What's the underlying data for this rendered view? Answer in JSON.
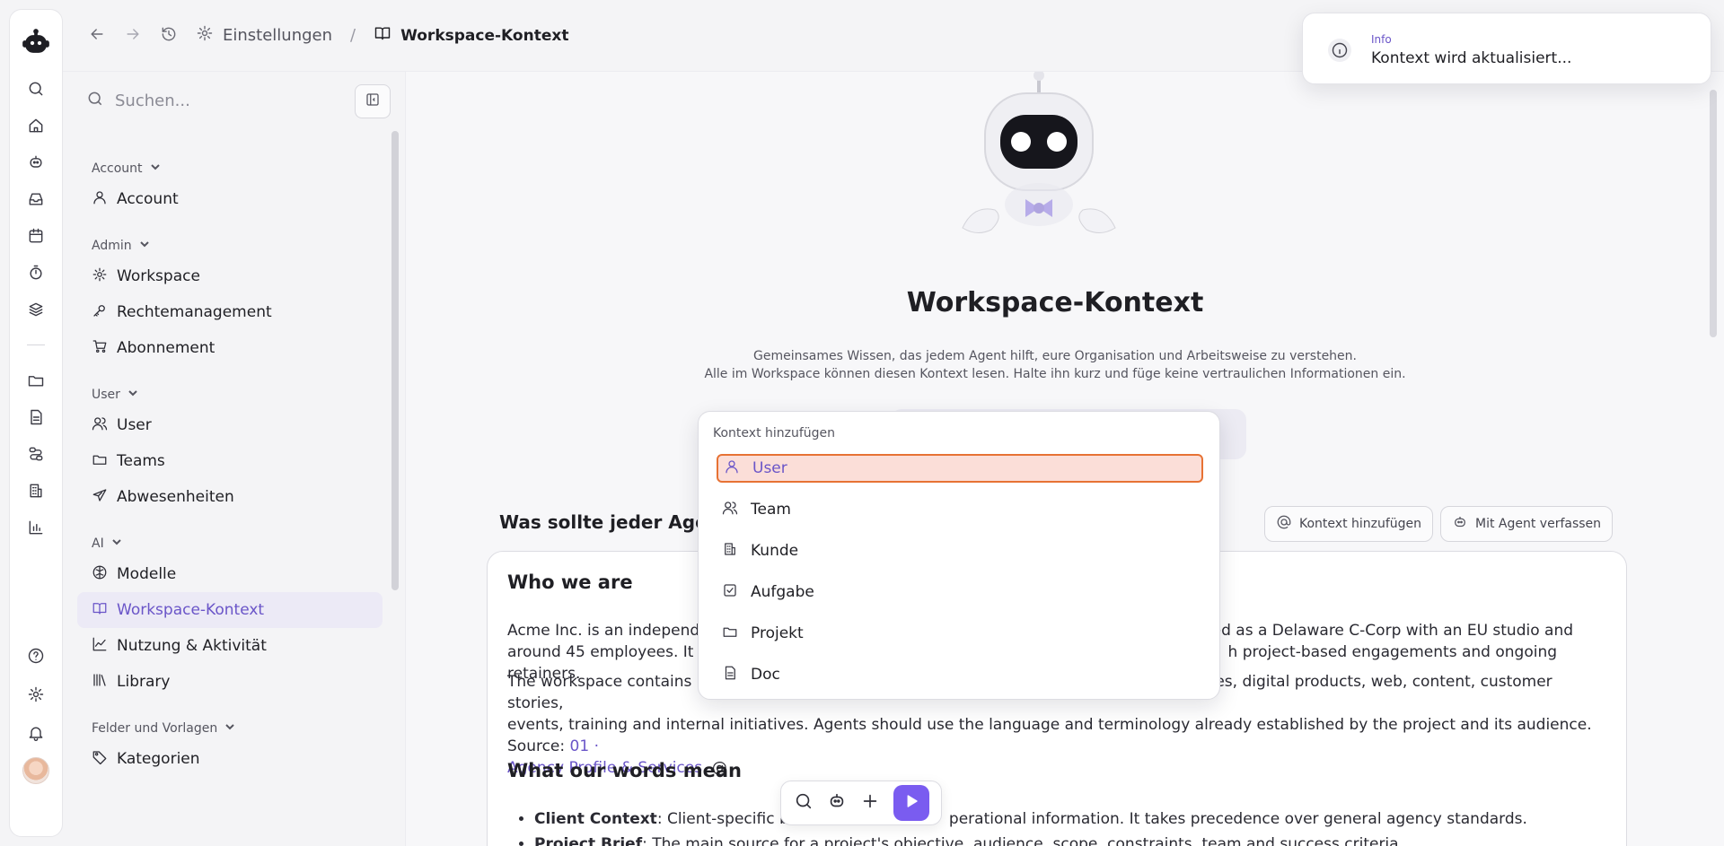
{
  "breadcrumb": {
    "settings": "Einstellungen",
    "separator": "/",
    "current": "Workspace-Kontext"
  },
  "sidebar": {
    "search_placeholder": "Suchen...",
    "sections": [
      {
        "label": "Account",
        "items": [
          "Account"
        ]
      },
      {
        "label": "Admin",
        "items": [
          "Workspace",
          "Rechtemanagement",
          "Abonnement"
        ]
      },
      {
        "label": "User",
        "items": [
          "User",
          "Teams",
          "Abwesenheiten"
        ]
      },
      {
        "label": "AI",
        "items": [
          "Modelle",
          "Workspace-Kontext",
          "Nutzung & Aktivität",
          "Library"
        ]
      },
      {
        "label": "Felder und Vorlagen",
        "items": [
          "Kategorien"
        ]
      }
    ]
  },
  "main": {
    "title": "Workspace-Kontext",
    "subtitle_1": "Gemeinsames Wissen, das jedem Agent hilft, eure Organisation und Arbeitsweise zu verstehen.",
    "subtitle_2": "Alle im Workspace können diesen Kontext lesen. Halte ihn kurz und füge keine vertraulichen Informationen ein.",
    "section_heading": "Was sollte jeder Agent",
    "add_context_label": "Kontext hinzufügen",
    "compose_label": "Mit Agent verfassen",
    "editor": {
      "h1": "Who we are",
      "p1_line1_a": "Acme Inc. is an independe",
      "p1_line1_b": "ed as a Delaware C-Corp with an EU studio and",
      "p1_line2_a": "around 45 employees. It su",
      "p1_line2_b": "h project-based engagements and ongoing retainers.",
      "p2_line1_a": "The workspace contains En",
      "p2_line1_b": "es, digital products, web, content, customer stories,",
      "p2_line2": "events, training and internal initiatives. Agents should use the language and terminology already established by the project and its audience. Source: ",
      "p2_link_a": "01 ·",
      "p2_link_b": "Agency Profile & Services",
      "p2_tail": ". @",
      "h2": "What our words mean",
      "li1_term": "Client Context",
      "li1_a": ": Client-specific bran",
      "li1_b": "perational information. It takes precedence over general agency standards.",
      "li2_term": "Project Brief",
      "li2_text": ": The main source for a project's objective, audience, scope, constraints, team and success criteria."
    }
  },
  "dropdown": {
    "heading": "Kontext hinzufügen",
    "items": [
      {
        "label": "User",
        "icon": "user-icon"
      },
      {
        "label": "Team",
        "icon": "users-icon"
      },
      {
        "label": "Kunde",
        "icon": "building-icon"
      },
      {
        "label": "Aufgabe",
        "icon": "checkbox-icon"
      },
      {
        "label": "Projekt",
        "icon": "folder-icon"
      },
      {
        "label": "Doc",
        "icon": "document-icon"
      }
    ],
    "selected": "User"
  },
  "toast": {
    "label": "Info",
    "message": "Kontext wird aktualisiert..."
  },
  "colors": {
    "accent": "#6a55c8",
    "send_button": "#7a5cf0",
    "highlight_border": "#e77234",
    "highlight_fill": "#fbded8"
  }
}
